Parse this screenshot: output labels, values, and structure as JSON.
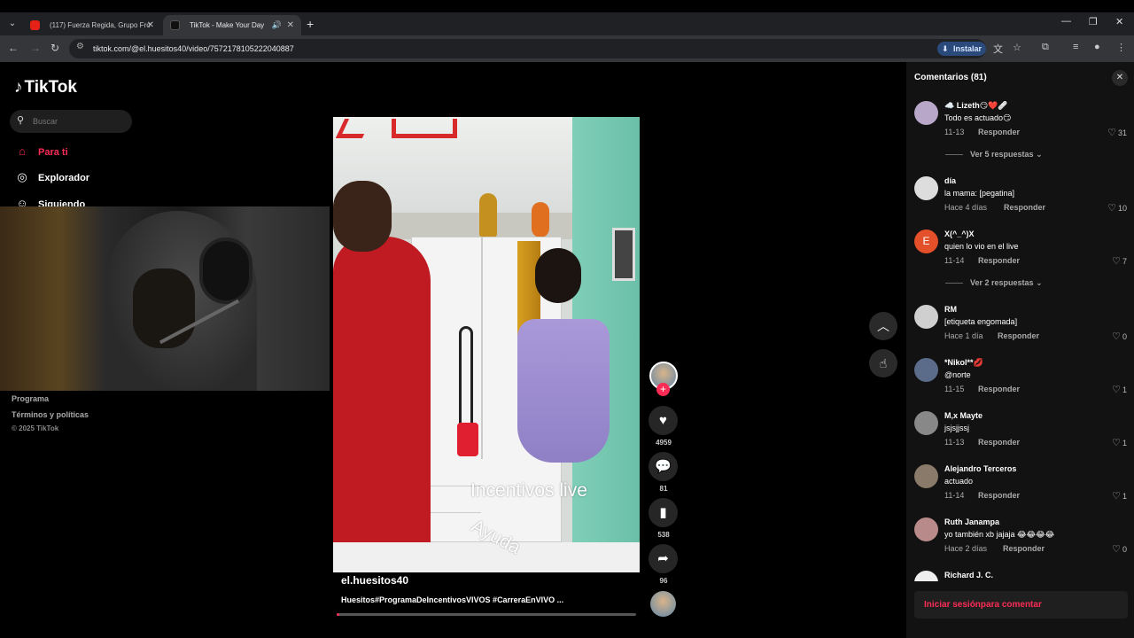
{
  "browser": {
    "tabs": [
      {
        "title": "(117) Fuerza Regida, Grupo Fro"
      },
      {
        "title": "TikTok - Make Your Day"
      }
    ],
    "url": "tiktok.com/@el.huesitos40/video/7572178105222040887",
    "install_label": "Instalar"
  },
  "sidebar": {
    "logo": "TikTok",
    "search_placeholder": "Buscar",
    "items": [
      {
        "label": "Para ti",
        "icon": "home-icon"
      },
      {
        "label": "Explorador",
        "icon": "compass-icon"
      },
      {
        "label": "Siguiendo",
        "icon": "person-icon"
      }
    ],
    "footer": {
      "program": "Programa",
      "terms": "Términos y políticas",
      "copyright": "© 2025 TikTok"
    }
  },
  "video": {
    "overlay_line1": "Incentivos live",
    "overlay_line2": "Ayuda",
    "author": "el.huesitos40",
    "caption": "Huesitos#ProgramaDeIncentivosVIVOS #CarreraEnVIVO ...",
    "progress": 0.01
  },
  "actions": {
    "likes": "4959",
    "comments": "81",
    "saves": "538",
    "shares": "96"
  },
  "comments_panel": {
    "title": "Comentarios (81)",
    "reply_label": "Responder",
    "items": [
      {
        "name": "☁️ Lizeth😏❤️🩹",
        "text": "Todo es actuado😏",
        "date": "11-13",
        "likes": "31",
        "view_replies": "Ver 5 respuestas"
      },
      {
        "name": "día",
        "text": "la mama: [pegatina]",
        "date": "Hace 4 días",
        "likes": "10"
      },
      {
        "name": "X(^_^)X",
        "text": "quien lo vio en el live",
        "date": "11-14",
        "likes": "7",
        "avatar_letter": "E",
        "view_replies": "Ver 2 respuestas"
      },
      {
        "name": "RM",
        "text": "[etiqueta engomada]",
        "date": "Hace 1 día",
        "likes": "0"
      },
      {
        "name": "*Nikol**💋",
        "text": "@norte",
        "date": "11-15",
        "likes": "1"
      },
      {
        "name": "M,x Mayte",
        "text": "jsjsjjssj",
        "date": "11-13",
        "likes": "1"
      },
      {
        "name": "Alejandro Terceros",
        "text": "actuado",
        "date": "11-14",
        "likes": "1"
      },
      {
        "name": "Ruth Janampa",
        "text": "yo también xb jajaja 😂😂😂😂",
        "date": "Hace 2 días",
        "likes": "0"
      },
      {
        "name": "Richard J. C."
      }
    ],
    "login_prompt": "Iniciar sesiónpara comentar"
  }
}
